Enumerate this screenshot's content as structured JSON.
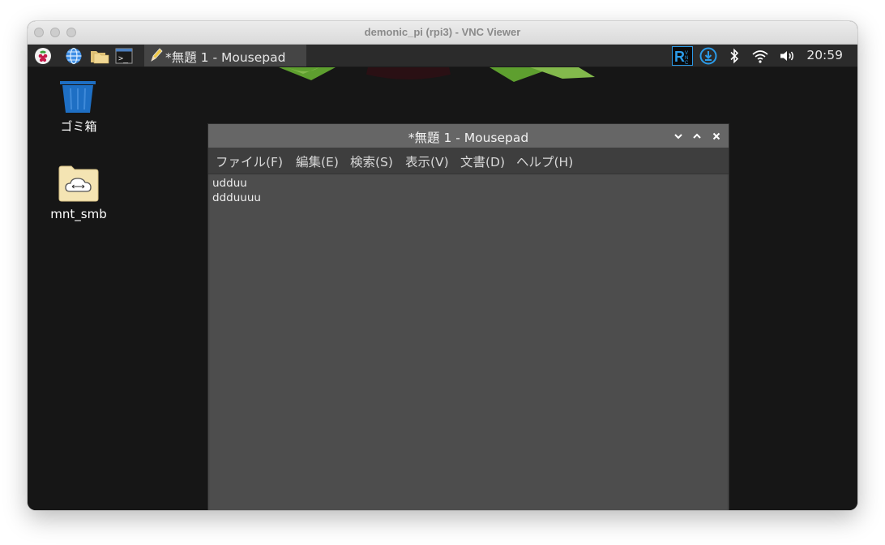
{
  "window": {
    "title": "demonic_pi (rpi3) - VNC Viewer"
  },
  "taskbar": {
    "icons": [
      "raspberry-menu-icon",
      "web-browser-icon",
      "file-manager-icon",
      "terminal-icon"
    ],
    "task_button_label": "*無題 1 - Mousepad",
    "tray_icons": [
      "realvnc-icon",
      "update-download-icon",
      "bluetooth-icon",
      "wifi-icon",
      "volume-icon"
    ],
    "clock": "20:59"
  },
  "desktop": {
    "icons": [
      {
        "label": "ゴミ箱",
        "icon": "trash-icon"
      },
      {
        "label": "mnt_smb",
        "icon": "network-folder-icon"
      }
    ]
  },
  "mousepad": {
    "title": "*無題 1 - Mousepad",
    "menu": [
      "ファイル(F)",
      "編集(E)",
      "検索(S)",
      "表示(V)",
      "文書(D)",
      "ヘルプ(H)"
    ],
    "lines": [
      "udduu",
      "ddduuuu"
    ]
  },
  "colors": {
    "taskbar_bg": "#2b2b2b",
    "titlebar_bg": "#666666",
    "editor_bg": "#4d4d4d",
    "trash_blue": "#1e6fc4",
    "tray_blue": "#2b9be9"
  }
}
